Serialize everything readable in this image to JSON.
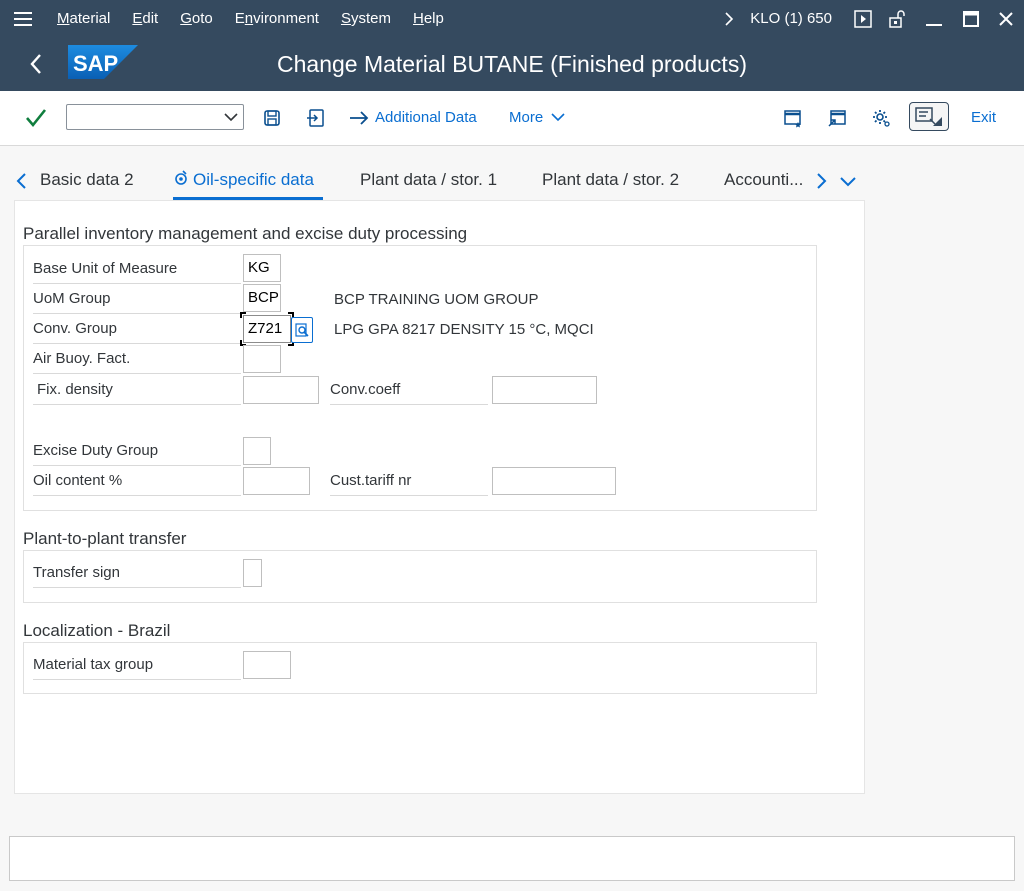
{
  "menubar": {
    "items": [
      {
        "first": "M",
        "rest": "aterial"
      },
      {
        "first": "E",
        "rest": "dit"
      },
      {
        "first": "G",
        "rest": "oto"
      },
      {
        "first": "",
        "rest": "Environment",
        "ul_index": 2
      },
      {
        "first": "S",
        "rest": "ystem"
      },
      {
        "first": "H",
        "rest": "elp"
      }
    ],
    "system_info": "KLO (1) 650"
  },
  "titlebar": {
    "title": "Change Material BUTANE (Finished products)",
    "logo_text": "SAP"
  },
  "toolbar": {
    "command_value": "",
    "additional_data": "Additional Data",
    "more": "More",
    "exit": "Exit"
  },
  "tabs": [
    {
      "label": "Basic data 2",
      "active": false
    },
    {
      "label": "Oil-specific data",
      "active": true
    },
    {
      "label": "Plant data / stor. 1",
      "active": false
    },
    {
      "label": "Plant data / stor. 2",
      "active": false
    },
    {
      "label": "Accounti...",
      "active": false
    }
  ],
  "sections": {
    "parallel": {
      "title": "Parallel inventory management and excise duty processing",
      "base_uom_label": "Base Unit of Measure",
      "base_uom_value": "KG",
      "uom_group_label": "UoM Group",
      "uom_group_value": "BCP",
      "uom_group_desc": "BCP TRAINING UOM GROUP",
      "conv_group_label": "Conv. Group",
      "conv_group_value": "Z721",
      "conv_group_desc": "LPG GPA 8217 DENSITY 15 °C, MQCI",
      "air_buoy_label": "Air Buoy. Fact.",
      "air_buoy_value": "",
      "fix_density_label": "Fix. density",
      "fix_density_value": "",
      "conv_coeff_label": "Conv.coeff",
      "conv_coeff_value": "",
      "excise_label": "Excise Duty Group",
      "excise_value": "",
      "oil_content_label": "Oil content %",
      "oil_content_value": "",
      "cust_tariff_label": "Cust.tariff nr",
      "cust_tariff_value": ""
    },
    "transfer": {
      "title": "Plant-to-plant transfer",
      "transfer_sign_label": "Transfer sign",
      "transfer_sign_value": ""
    },
    "brazil": {
      "title": "Localization - Brazil",
      "tax_group_label": "Material tax group",
      "tax_group_value": ""
    }
  },
  "colors": {
    "shell": "#354a5f",
    "accent": "#0a6ed1",
    "check": "#107e3e"
  },
  "icons": [
    "menu-icon",
    "chevron-right-icon",
    "play-icon",
    "lock-icon",
    "minimize-icon",
    "maximize-icon",
    "close-icon",
    "back-icon",
    "checkmark-icon",
    "dropdown-icon",
    "save-icon",
    "shortcut-icon",
    "arrow-right-icon",
    "chevron-down-icon",
    "new-window-icon",
    "generate-shortcut-icon",
    "settings-icon",
    "toggle-icon",
    "search-help-icon"
  ]
}
